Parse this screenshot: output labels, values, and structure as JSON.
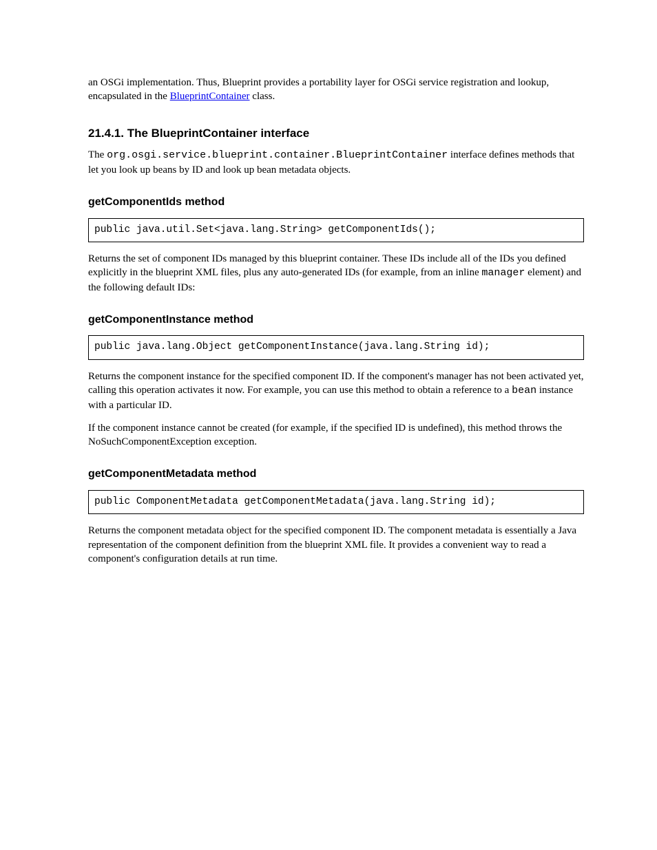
{
  "para1": {
    "pre": "an OSGi implementation. Thus, Blueprint provides a portability layer for OSGi service registration and lookup, encapsulated in the ",
    "link": "BlueprintContainer",
    "post": " class."
  },
  "headingSection": "21.4.1. The BlueprintContainer interface",
  "sectionIntro": {
    "pre": "The ",
    "code": "org.osgi.service.blueprint.container.BlueprintContainer",
    "post": " interface defines methods that let you look up beans by ID and look up bean metadata objects."
  },
  "componentIds": {
    "heading": "getComponentIds method",
    "sig": "public java.util.Set<java.lang.String> getComponentIds();",
    "desc": {
      "pre": "Returns the set of component IDs managed by this blueprint container. These IDs include all of the IDs you defined explicitly in the blueprint XML files, plus any auto-generated IDs (for example, from an inline ",
      "code": "manager",
      "post": " element) and the following default IDs:"
    }
  },
  "componentInstance": {
    "heading": "getComponentInstance method",
    "sig": "public java.lang.Object getComponentInstance(java.lang.String id);",
    "desc": {
      "pre": "Returns the component instance for the specified component ID. If the component's manager has not been activated yet, calling this operation activates it now. For example, you can use this method to obtain a reference to a ",
      "code": "bean",
      "post": " instance with a particular ID."
    },
    "desc2": "If the component instance cannot be created (for example, if the specified ID is undefined), this method throws the NoSuchComponentException exception."
  },
  "componentMetadata": {
    "heading": "getComponentMetadata method",
    "sig": "public ComponentMetadata getComponentMetadata(java.lang.String id);",
    "desc": "Returns the component metadata object for the specified component ID. The component metadata is essentially a Java representation of the component definition from the blueprint XML file. It provides a convenient way to read a component's configuration details at run time."
  }
}
